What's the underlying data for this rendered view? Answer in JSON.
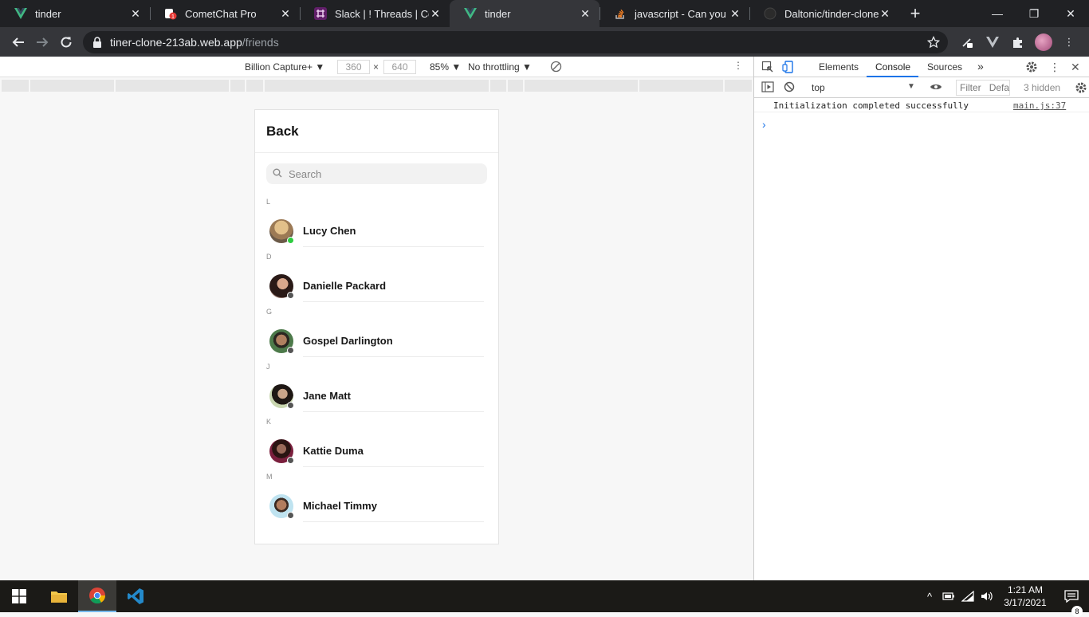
{
  "browser": {
    "tabs": [
      {
        "title": "tinder",
        "icon": "vue-icon",
        "active": false
      },
      {
        "title": "CometChat Pro",
        "icon": "cometchat-icon",
        "active": false
      },
      {
        "title": "Slack | ! Threads | Come",
        "icon": "slack-icon",
        "active": false
      },
      {
        "title": "tinder",
        "icon": "vue-icon",
        "active": true
      },
      {
        "title": "javascript - Can you for",
        "icon": "stackoverflow-icon",
        "active": false
      },
      {
        "title": "Daltonic/tinder-clone: A",
        "icon": "github-icon",
        "active": false
      }
    ],
    "url_host": "tiner-clone-213ab.web.app",
    "url_path": "/friends"
  },
  "device_toolbar": {
    "device": "Billion Capture+ ▼",
    "width": "360",
    "height": "640",
    "x_sep": "×",
    "zoom": "85% ▼",
    "throttle": "No throttling ▼"
  },
  "app": {
    "header_title": "Back",
    "search_placeholder": "Search",
    "groups": [
      {
        "letter": "L",
        "name": "Lucy Chen",
        "online": true
      },
      {
        "letter": "D",
        "name": "Danielle Packard",
        "online": false
      },
      {
        "letter": "G",
        "name": "Gospel Darlington",
        "online": false
      },
      {
        "letter": "J",
        "name": "Jane Matt",
        "online": false
      },
      {
        "letter": "K",
        "name": "Kattie Duma",
        "online": false
      },
      {
        "letter": "M",
        "name": "Michael Timmy",
        "online": false
      }
    ],
    "colors": {
      "online": "#2ecc40",
      "offline": "#555555"
    }
  },
  "devtools": {
    "tabs": [
      "Elements",
      "Console",
      "Sources"
    ],
    "active_tab": "Console",
    "context": "top",
    "filter_placeholder": "Filter",
    "levels": "Defa",
    "hidden": "3 hidden",
    "console_message": "Initialization completed successfully",
    "console_source": "main.js:37",
    "prompt": "›"
  },
  "taskbar": {
    "time": "1:21 AM",
    "date": "3/17/2021",
    "notification_count": "8"
  }
}
